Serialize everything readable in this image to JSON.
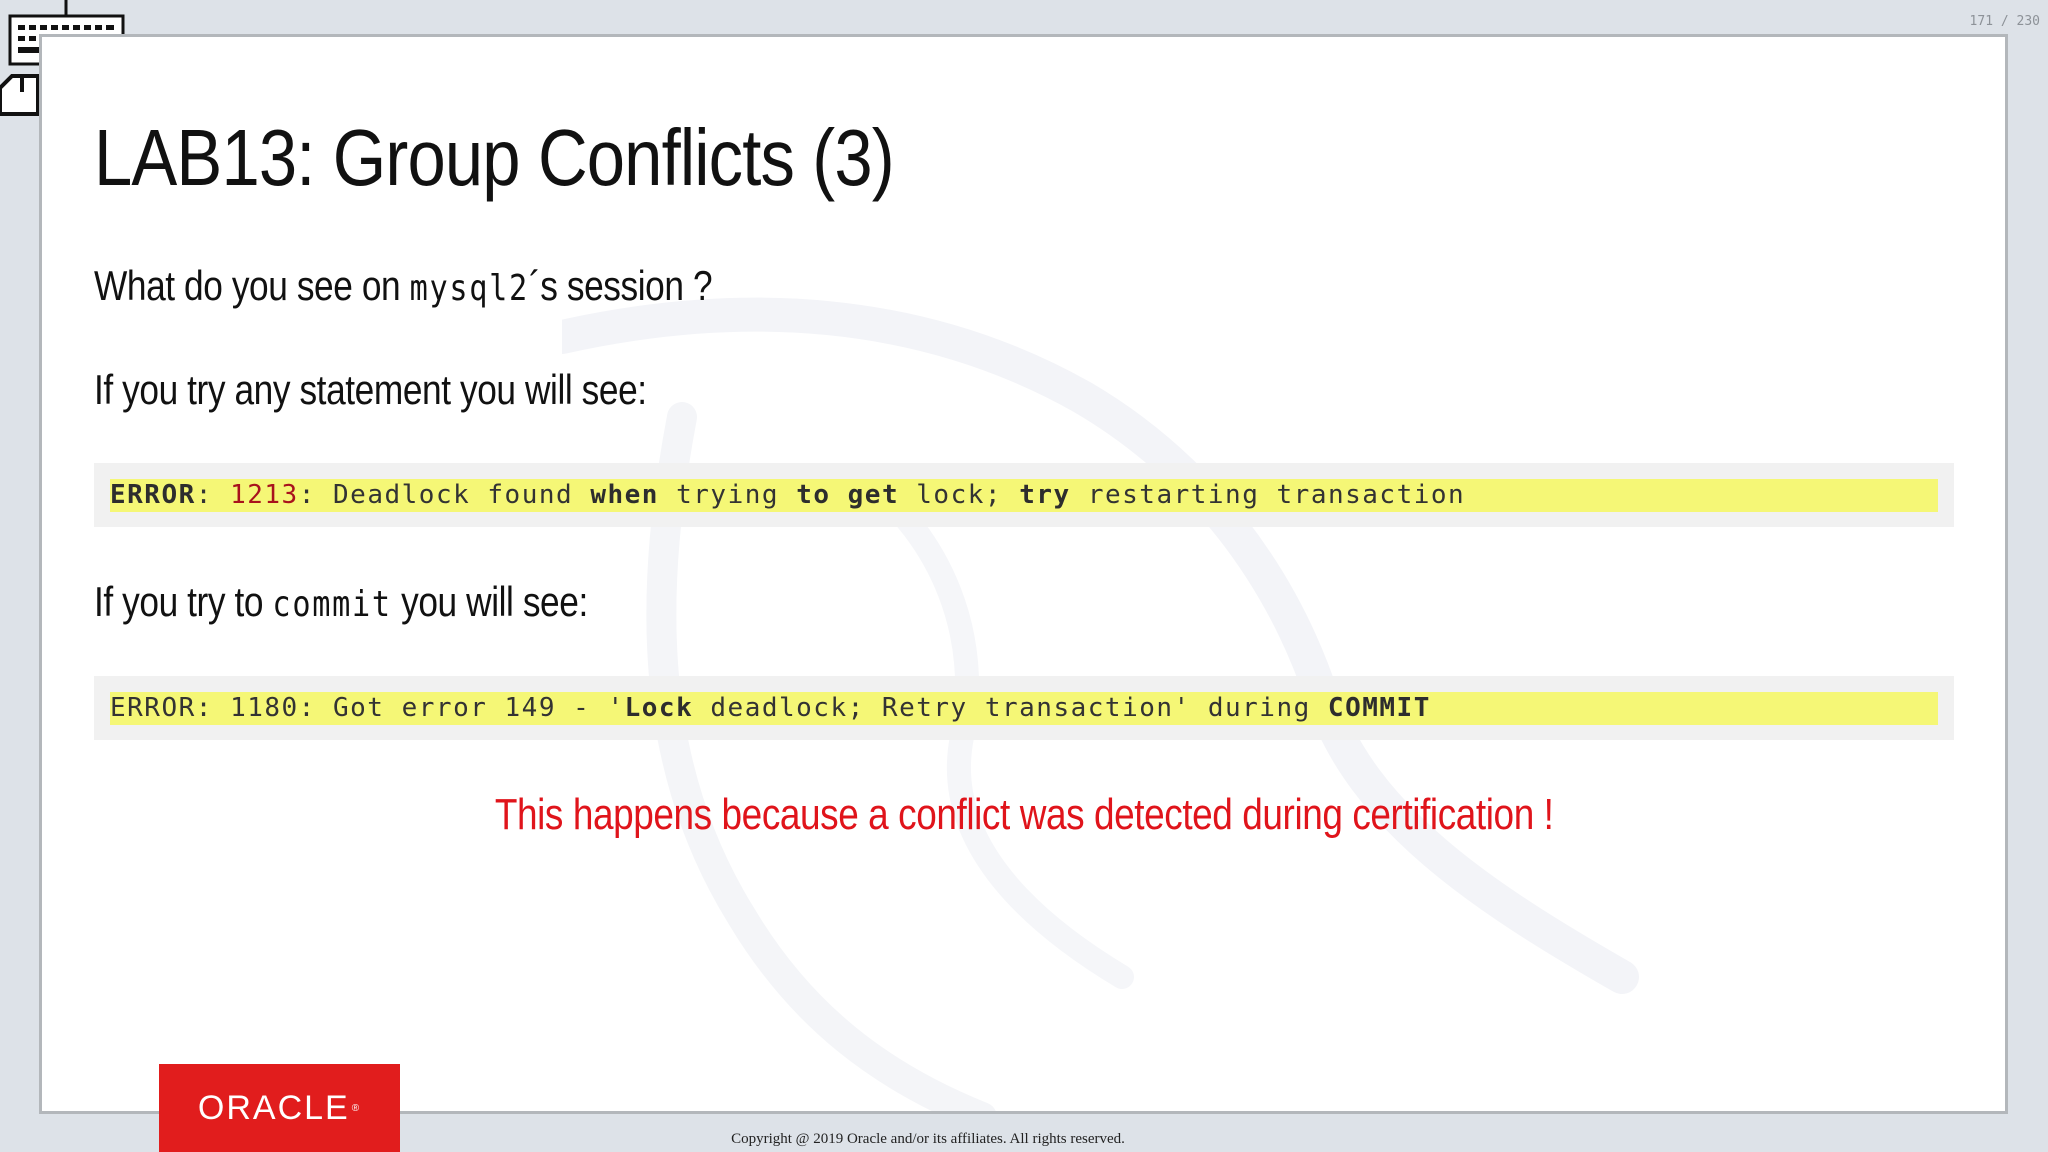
{
  "page_counter": "171 / 230",
  "slide": {
    "title": "LAB13: Group Conflicts (3)",
    "line1": {
      "before": "What do you see on ",
      "code": "mysql2",
      "after": "´s session ?"
    },
    "line2": "If you try any statement you will see:",
    "code1": {
      "error_kw": "ERROR",
      "sep1": ": ",
      "code": "1213",
      "t1": ": Deadlock found ",
      "kw_when": "when",
      "t2": " trying ",
      "kw_to": "to",
      "t3": " ",
      "kw_get": "get",
      "t4": " lock; ",
      "kw_try": "try",
      "t5": " restarting transaction"
    },
    "line3": {
      "before": "If you try to ",
      "code": "commit",
      "after": " you will see:"
    },
    "code2": {
      "t1": "ERROR: 1180: Got error 149 - '",
      "kw_lock": "Lock",
      "t2": " deadlock; Retry transaction' during ",
      "kw_commit": "COMMIT"
    },
    "alert": "This happens because a conflict was detected during certification !"
  },
  "footer": {
    "brand": "ORACLE",
    "registered": "®",
    "copyright": "Copyright @ 2019 Oracle and/or its affiliates. All rights reserved."
  },
  "colors": {
    "accent": "#e0141b",
    "highlight": "#f5f776",
    "brand": "#e11d1d"
  }
}
